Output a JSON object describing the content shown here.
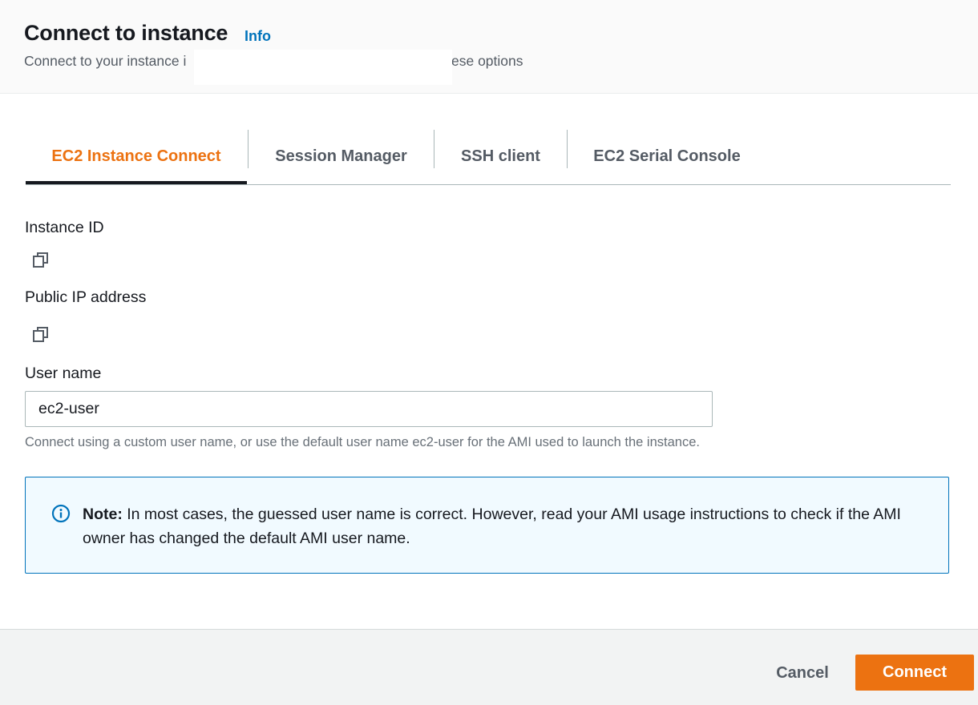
{
  "header": {
    "title": "Connect to instance",
    "info_link": "Info",
    "subtitle_start": "Connect to your instance i",
    "subtitle_end": "ese options"
  },
  "tabs": [
    {
      "label": "EC2 Instance Connect",
      "active": true
    },
    {
      "label": "Session Manager",
      "active": false
    },
    {
      "label": "SSH client",
      "active": false
    },
    {
      "label": "EC2 Serial Console",
      "active": false
    }
  ],
  "fields": {
    "instance_id_label": "Instance ID",
    "public_ip_label": "Public IP address",
    "user_name_label": "User name",
    "user_name_value": "ec2-user",
    "user_name_hint": "Connect using a custom user name, or use the default user name ec2-user for the AMI used to launch the instance."
  },
  "note": {
    "prefix": "Note:",
    "text": " In most cases, the guessed user name is correct. However, read your AMI usage instructions to check if the AMI owner has changed the default AMI user name."
  },
  "footer": {
    "cancel_label": "Cancel",
    "connect_label": "Connect"
  },
  "colors": {
    "accent_orange": "#ec7211",
    "link_blue": "#0073bb",
    "info_bg": "#f1faff"
  },
  "icons": {
    "copy": "copy-icon",
    "info": "info-circle-icon"
  }
}
